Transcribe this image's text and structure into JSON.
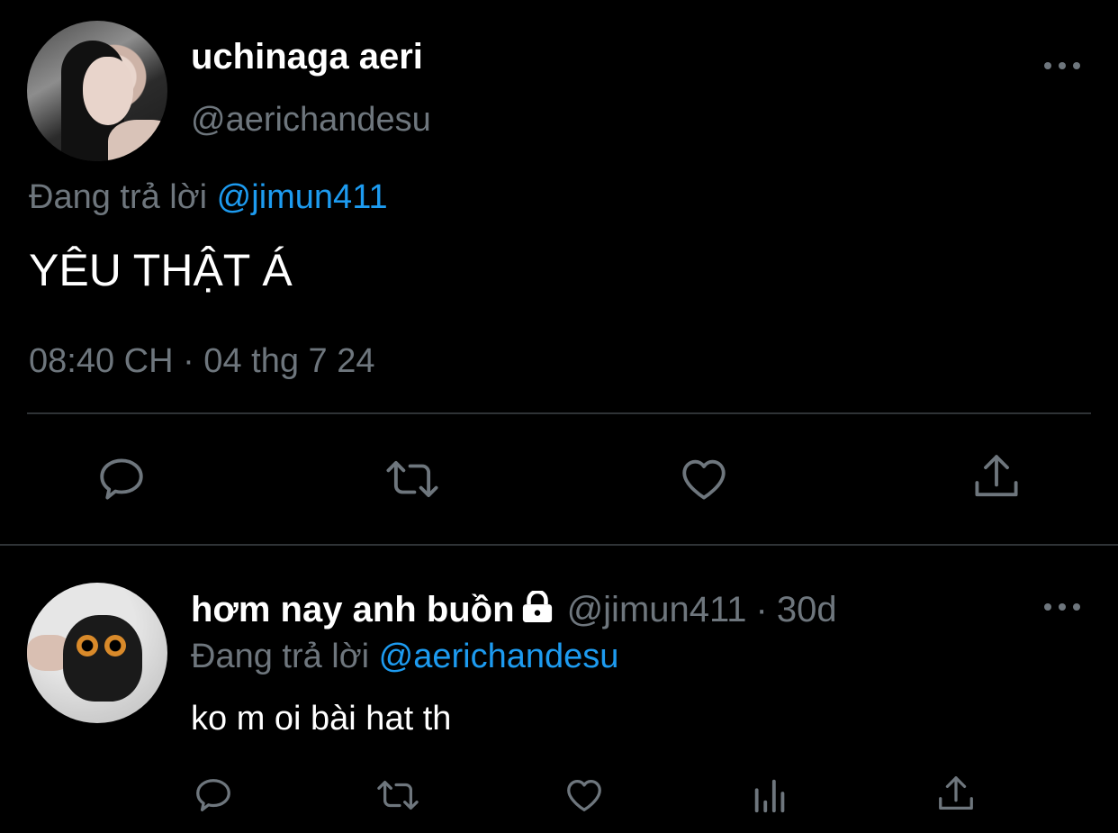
{
  "main_tweet": {
    "display_name": "uchinaga aeri",
    "handle": "@aerichandesu",
    "replying_label": "Đang trả lời",
    "replying_to": "@jimun411",
    "text": "YÊU THẬT Á",
    "timestamp": "08:40 CH · 04 thg 7 24",
    "avatar_icon": "profile-photo",
    "actions": [
      "reply-icon",
      "retweet-icon",
      "like-icon",
      "share-icon"
    ]
  },
  "reply_tweet": {
    "display_name": "hơm nay anh buồn",
    "protected_icon": "lock-icon",
    "handle": "@jimun411",
    "separator": "·",
    "age": "30d",
    "replying_label": "Đang trả lời",
    "replying_to": "@aerichandesu",
    "text": "ko m oi bài hat th",
    "avatar_icon": "owl-photo",
    "actions": [
      "reply-icon",
      "retweet-icon",
      "like-icon",
      "analytics-icon",
      "share-icon"
    ]
  },
  "colors": {
    "background": "#000000",
    "text_primary": "#ffffff",
    "text_secondary": "#6e767d",
    "accent": "#1d9bf0",
    "divider": "#2f3336"
  }
}
